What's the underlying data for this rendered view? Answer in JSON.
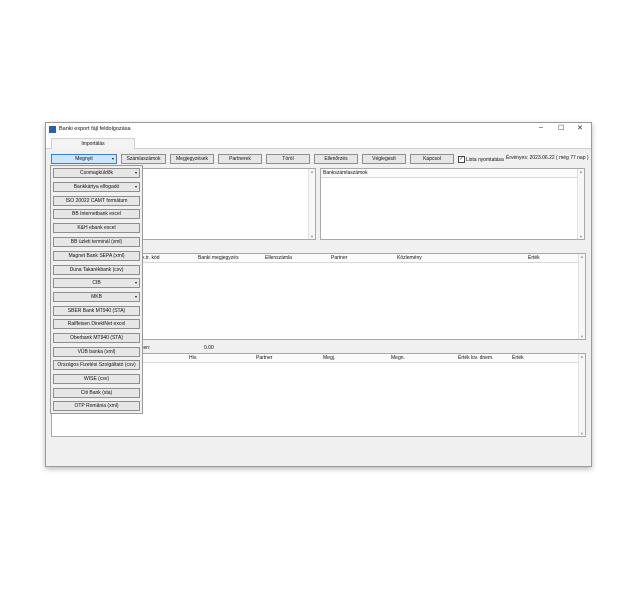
{
  "window": {
    "title": "Banki export fájl feldolgozása",
    "controls": {
      "minimize": "–",
      "maximize": "☐",
      "close": "✕"
    }
  },
  "tabs": [
    {
      "label": "Importálás"
    }
  ],
  "toolbar": {
    "buttons": [
      {
        "label": "Megnyit",
        "has_dropdown": true
      },
      {
        "label": "Számlaszámok"
      },
      {
        "label": "Megjegyzések"
      },
      {
        "label": "Partnerek"
      },
      {
        "label": "Töröl"
      },
      {
        "label": "Ellenőrzés"
      },
      {
        "label": "Véglegesít"
      },
      {
        "label": "Kapcsol"
      }
    ],
    "checkbox": {
      "label": "Lista nyomtatása",
      "checked": true
    },
    "validity": "Érvényes: 2023.06.22 ( még 77 nap )"
  },
  "top_right_panel": {
    "header": "Bankszámlaszámok"
  },
  "main_grid": {
    "columns": [
      "k.tr. kód",
      "Banki megjegyzés",
      "Ellenszámla",
      "Partner",
      "Közlemény",
      "Érték"
    ]
  },
  "sum_row": {
    "label": "sen:",
    "value": "0.00"
  },
  "bottom_grid": {
    "columns": [
      "Hiv.",
      "Partner",
      "Megj.",
      "Megn.",
      "Érték kiv. dnem.",
      "Érték"
    ]
  },
  "dropdown_menu": {
    "items": [
      {
        "label": "Csomagküldők",
        "has_arrow": true
      },
      {
        "label": "Bankkártya elfogadó",
        "has_arrow": true
      },
      {
        "label": "ISO 20022 CAMT formátum"
      },
      {
        "label": "BB Internetbank excel"
      },
      {
        "label": "K&H ebank excel"
      },
      {
        "label": "BB üzleti terminál (xml)"
      },
      {
        "label": "Magnet Bank SEPA (xml)"
      },
      {
        "label": "Duna Takarékbank (csv)"
      },
      {
        "label": "CIB",
        "has_arrow": true
      },
      {
        "label": "MKB",
        "has_arrow": true
      },
      {
        "label": "SBER Bank MT940 (STA)"
      },
      {
        "label": "Raiffeisen DirektNet excel"
      },
      {
        "label": "Oberbank MT940 (STA)"
      },
      {
        "label": "VÚB banka (xml)"
      },
      {
        "label": "Országos Fizetési Szolgáltató (csv)"
      },
      {
        "label": "WISE (csv)"
      },
      {
        "label": "Citi Bank (sta)"
      },
      {
        "label": "OTP România (xml)"
      }
    ]
  },
  "scroll_glyphs": {
    "up": "▲",
    "down": "▼"
  },
  "icons": {
    "dropdown_arrow": "▾",
    "check": "✓"
  }
}
